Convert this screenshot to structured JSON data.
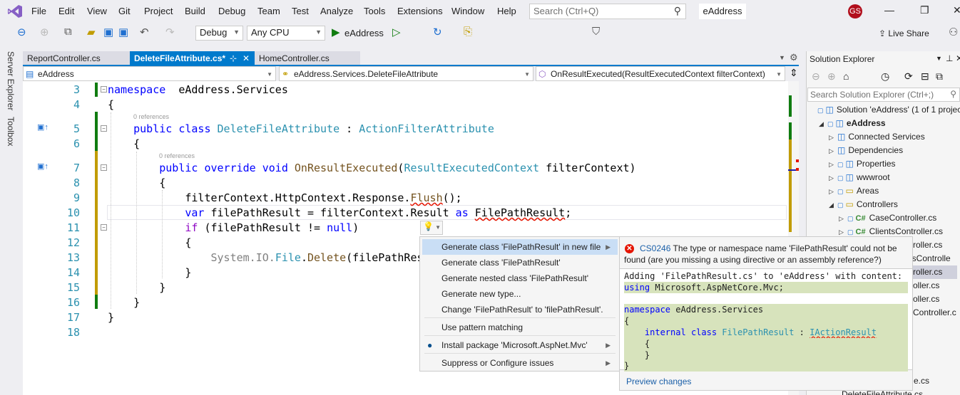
{
  "menu": [
    "File",
    "Edit",
    "View",
    "Git",
    "Project",
    "Build",
    "Debug",
    "Team",
    "Test",
    "Analyze",
    "Tools",
    "Extensions",
    "Window",
    "Help"
  ],
  "search": {
    "placeholder": "Search (Ctrl+Q)"
  },
  "window_title": "eAddress",
  "user_initials": "GS",
  "toolbar": {
    "config": "Debug",
    "platform": "Any CPU",
    "run_target": "eAddress",
    "live_share": "Live Share"
  },
  "side_tabs": [
    "Server Explorer",
    "Toolbox"
  ],
  "tabs": [
    {
      "label": "ReportController.cs"
    },
    {
      "label": "DeleteFileAttribute.cs*",
      "active": true
    },
    {
      "label": "HomeController.cs"
    }
  ],
  "nav": {
    "project": "eAddress",
    "type": "eAddress.Services.DeleteFileAttribute",
    "member": "OnResultExecuted(ResultExecutedContext filterContext)"
  },
  "code_lines": [
    {
      "n": "3",
      "tokens": [
        [
          "kw",
          "namespace"
        ],
        [
          "",
          "  eAddress.Services"
        ]
      ]
    },
    {
      "n": "4",
      "tokens": [
        [
          "",
          "{"
        ]
      ]
    },
    {
      "n": "5",
      "lens": "0 references",
      "tokens": [
        [
          "",
          "    "
        ],
        [
          "kw",
          "public"
        ],
        [
          "",
          " "
        ],
        [
          "kw",
          "class"
        ],
        [
          "",
          " "
        ],
        [
          "ty",
          "DeleteFileAttribute"
        ],
        [
          "",
          " : "
        ],
        [
          "ty",
          "ActionFilterAttribute"
        ]
      ]
    },
    {
      "n": "6",
      "tokens": [
        [
          "",
          "    {"
        ]
      ]
    },
    {
      "n": "7",
      "lens": "0 references",
      "tokens": [
        [
          "",
          "        "
        ],
        [
          "kw",
          "public"
        ],
        [
          "",
          " "
        ],
        [
          "kw",
          "override"
        ],
        [
          "",
          " "
        ],
        [
          "kw",
          "void"
        ],
        [
          "",
          " "
        ],
        [
          "me",
          "OnResultExecuted"
        ],
        [
          "",
          "("
        ],
        [
          "ty",
          "ResultExecutedContext"
        ],
        [
          "",
          " filterContext)"
        ]
      ]
    },
    {
      "n": "8",
      "tokens": [
        [
          "",
          "        {"
        ]
      ]
    },
    {
      "n": "9",
      "tokens": [
        [
          "",
          "            filterContext.HttpContext.Response."
        ],
        [
          "me sq",
          "Flush"
        ],
        [
          "",
          "();"
        ]
      ]
    },
    {
      "n": "10",
      "tokens": [
        [
          "",
          "            "
        ],
        [
          "kw",
          "var"
        ],
        [
          "",
          " filePathResult = filterContext.Result "
        ],
        [
          "kw",
          "as"
        ],
        [
          "",
          " "
        ],
        [
          "sq",
          "FilePathResult"
        ],
        [
          "",
          ";"
        ]
      ]
    },
    {
      "n": "11",
      "tokens": [
        [
          "",
          "            "
        ],
        [
          "ctl",
          "if"
        ],
        [
          "",
          " (filePathResult != "
        ],
        [
          "kw",
          "null"
        ],
        [
          "",
          ")"
        ]
      ]
    },
    {
      "n": "12",
      "tokens": [
        [
          "",
          "            {"
        ]
      ]
    },
    {
      "n": "13",
      "tokens": [
        [
          "",
          "                "
        ],
        [
          "gr",
          "System.IO."
        ],
        [
          "ty",
          "File"
        ],
        [
          "",
          "."
        ],
        [
          "me",
          "Delete"
        ],
        [
          "",
          "(filePathRes"
        ]
      ]
    },
    {
      "n": "14",
      "tokens": [
        [
          "",
          "            }"
        ]
      ]
    },
    {
      "n": "15",
      "tokens": [
        [
          "",
          "        }"
        ]
      ]
    },
    {
      "n": "16",
      "tokens": [
        [
          "",
          "    }"
        ]
      ]
    },
    {
      "n": "17",
      "tokens": [
        [
          "",
          "}"
        ]
      ]
    },
    {
      "n": "18",
      "tokens": []
    }
  ],
  "solution_explorer": {
    "title": "Solution Explorer",
    "search_placeholder": "Search Solution Explorer (Ctrl+;)",
    "items": [
      {
        "label": "Solution 'eAddress' (1 of 1 project",
        "level": 0,
        "exp": "",
        "lock": true,
        "icon": "solution-icon"
      },
      {
        "label": "eAddress",
        "level": 1,
        "exp": "◢",
        "lock": true,
        "bold": true,
        "icon": "project-icon"
      },
      {
        "label": "Connected Services",
        "level": 2,
        "exp": "▷",
        "icon": "cloud-icon"
      },
      {
        "label": "Dependencies",
        "level": 2,
        "exp": "▷",
        "icon": "dependencies-icon"
      },
      {
        "label": "Properties",
        "level": 2,
        "exp": "▷",
        "lock": true,
        "icon": "wrench-icon"
      },
      {
        "label": "wwwroot",
        "level": 2,
        "exp": "▷",
        "lock": true,
        "icon": "globe-icon"
      },
      {
        "label": "Areas",
        "level": 2,
        "exp": "▷",
        "lock": true,
        "icon": "folder-icon"
      },
      {
        "label": "Controllers",
        "level": 2,
        "exp": "◢",
        "lock": true,
        "icon": "folder-open-icon"
      },
      {
        "label": "CaseController.cs",
        "level": 3,
        "exp": "▷",
        "lock": true,
        "cs": true
      },
      {
        "label": "ClientsController.cs",
        "level": 3,
        "exp": "▷",
        "lock": true,
        "cs": true
      }
    ],
    "partial": [
      "roller.cs",
      "nsControlle",
      "roller.cs",
      "oller.cs",
      "oller.cs",
      "Controller.c"
    ],
    "partial_bottom": [
      "e.cs",
      "DeleteFileAttribute.cs"
    ]
  },
  "quick_actions": [
    {
      "label": "Generate class 'FilePathResult' in new file",
      "sub": true,
      "selected": true
    },
    {
      "label": "Generate class 'FilePathResult'"
    },
    {
      "label": "Generate nested class 'FilePathResult'"
    },
    {
      "label": "Generate new type..."
    },
    {
      "label": "Change 'FilePathResult' to 'filePathResult'."
    },
    {
      "label": "Use pattern matching"
    },
    {
      "label": "Install package 'Microsoft.AspNet.Mvc'",
      "sub": true,
      "icon": "nuget-icon"
    },
    {
      "label": "Suppress or Configure issues",
      "sub": true
    }
  ],
  "preview": {
    "error_code": "CS0246",
    "error_text": "The type or namespace name 'FilePathResult' could not be found (are you missing a using directive or an assembly reference?)",
    "lines": [
      {
        "add": false,
        "tokens": [
          [
            "",
            "Adding 'FilePathResult.cs' to 'eAddress' with content:"
          ]
        ]
      },
      {
        "add": true,
        "tokens": [
          [
            "kw",
            "using"
          ],
          [
            "",
            " Microsoft.AspNetCore.Mvc;"
          ]
        ]
      },
      {
        "add": false,
        "tokens": []
      },
      {
        "add": true,
        "tokens": [
          [
            "kw",
            "namespace"
          ],
          [
            "",
            " eAddress.Services"
          ]
        ]
      },
      {
        "add": true,
        "tokens": [
          [
            "",
            "{"
          ]
        ]
      },
      {
        "add": true,
        "tokens": [
          [
            "",
            "    "
          ],
          [
            "kw",
            "internal"
          ],
          [
            "",
            " "
          ],
          [
            "kw",
            "class"
          ],
          [
            "",
            " "
          ],
          [
            "ty",
            "FilePathResult"
          ],
          [
            "",
            " : "
          ],
          [
            "ty sq",
            "IActionResult"
          ]
        ]
      },
      {
        "add": true,
        "tokens": [
          [
            "",
            "    {"
          ]
        ]
      },
      {
        "add": true,
        "tokens": [
          [
            "",
            "    }"
          ]
        ]
      },
      {
        "add": true,
        "tokens": [
          [
            "",
            "}"
          ]
        ]
      }
    ],
    "link": "Preview changes"
  },
  "colors": {
    "accent": "#007acc",
    "change_saved": "#107c10",
    "change_unsaved": "#c19c00",
    "error": "#e51400",
    "selected": "#c9def5"
  }
}
